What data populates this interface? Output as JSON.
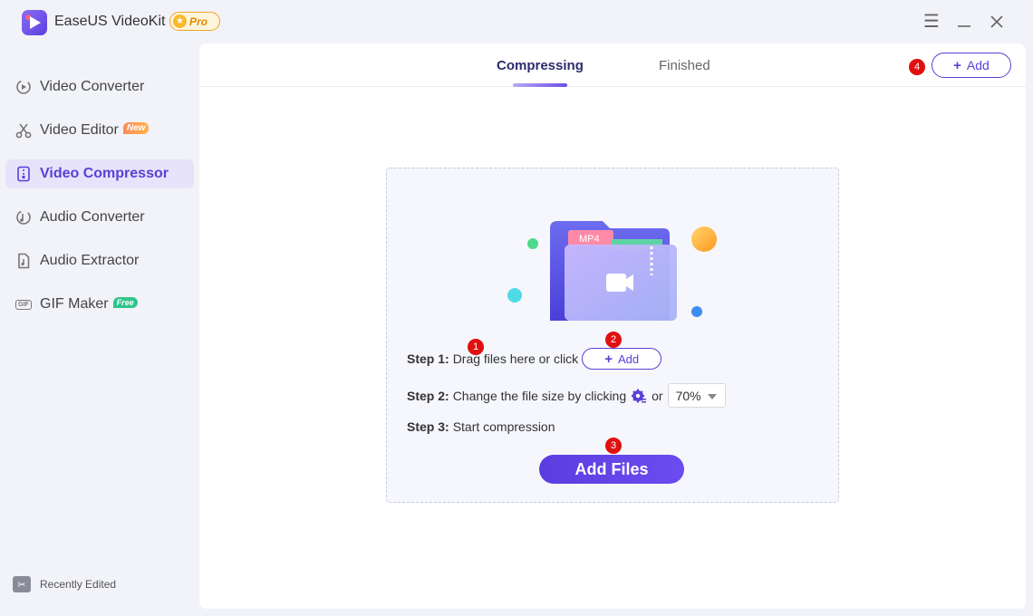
{
  "app": {
    "title": "EaseUS VideoKit",
    "badge": "Pro"
  },
  "window_controls": {
    "menu_icon": "hamburger-icon",
    "minimize_icon": "minimize-icon",
    "close_icon": "close-icon"
  },
  "sidebar": {
    "items": [
      {
        "label": "Video Converter",
        "icon": "video-convert-icon",
        "active": false
      },
      {
        "label": "Video Editor",
        "icon": "scissors-icon",
        "tag": "New",
        "active": false
      },
      {
        "label": "Video Compressor",
        "icon": "compress-icon",
        "active": true
      },
      {
        "label": "Audio Converter",
        "icon": "audio-convert-icon",
        "active": false
      },
      {
        "label": "Audio Extractor",
        "icon": "audio-file-icon",
        "active": false
      },
      {
        "label": "GIF Maker",
        "icon": "gif-icon",
        "icon_text": "GIF",
        "tag": "Free",
        "active": false
      }
    ],
    "footer": {
      "label": "Recently Edited",
      "icon": "recent-edit-icon"
    }
  },
  "main": {
    "tabs": [
      {
        "label": "Compressing",
        "active": true
      },
      {
        "label": "Finished",
        "active": false
      }
    ],
    "top_add_label": "Add",
    "illustration": {
      "folder_label": "MP4"
    },
    "steps": {
      "step1_prefix": "Step 1:",
      "step1_text": "Drag files here or click",
      "step1_button": "Add",
      "step2_prefix": "Step 2:",
      "step2_text": "Change the file size by clicking",
      "step2_or": "or",
      "step2_select_value": "70%",
      "step3_prefix": "Step 3:",
      "step3_text": "Start compression"
    },
    "primary_button": "Add Files",
    "markers": [
      "1",
      "2",
      "3",
      "4"
    ]
  },
  "colors": {
    "accent": "#5b3fd6",
    "marker": "#e01010",
    "badge": "#f0a52a"
  }
}
